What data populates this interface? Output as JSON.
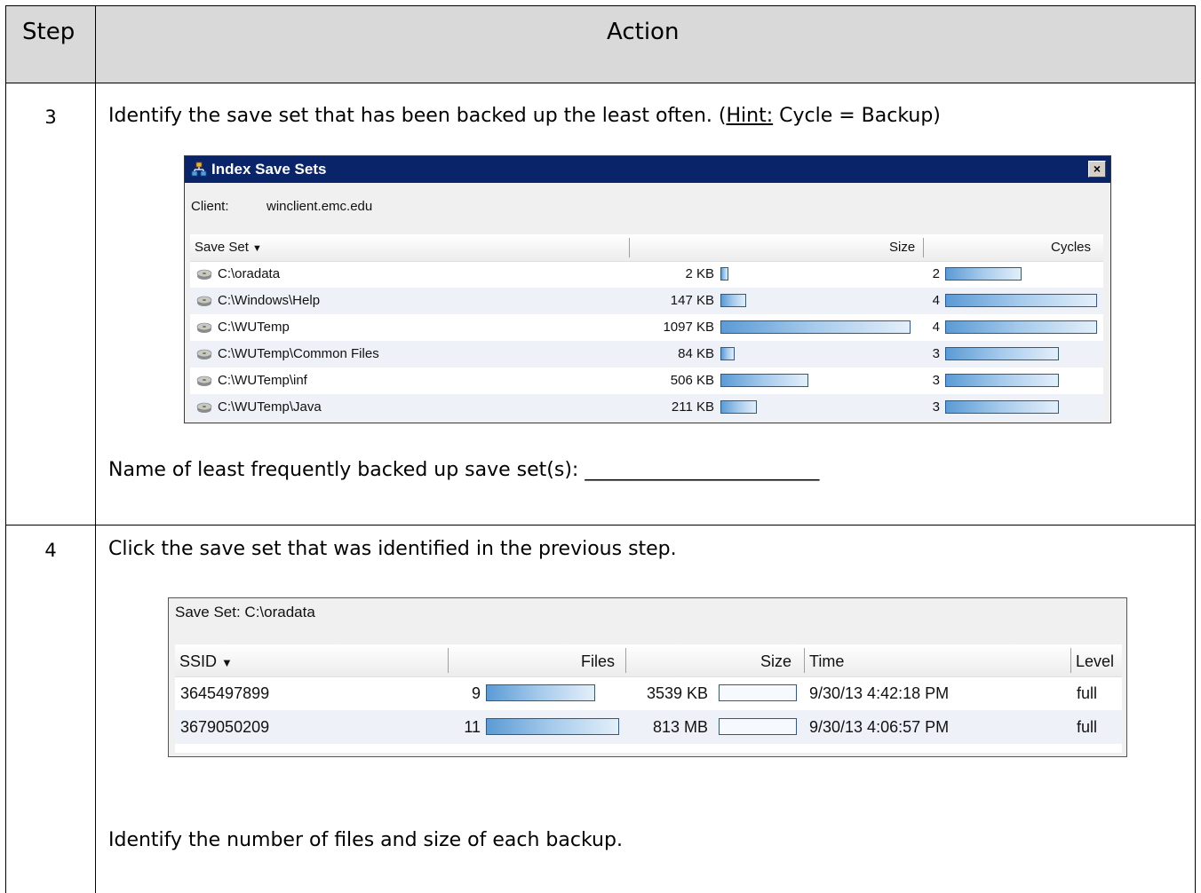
{
  "header": {
    "step": "Step",
    "action": "Action"
  },
  "step3": {
    "num": "3",
    "instruction_pre": "Identify the save set that has been backed up the least often.  (",
    "hint_label": "Hint:",
    "instruction_post": " Cycle = Backup)",
    "dialog": {
      "title": "Index Save Sets",
      "close": "×",
      "client_label": "Client:",
      "client_value": "winclient.emc.edu",
      "col_saveset": "Save Set",
      "col_size": "Size",
      "col_cycles": "Cycles",
      "sort_arrow": "▼",
      "rows": [
        {
          "name": "C:\\oradata",
          "size": "2 KB",
          "size_kb": 2,
          "cycles": "2",
          "cycles_n": 2
        },
        {
          "name": "C:\\Windows\\Help",
          "size": "147 KB",
          "size_kb": 147,
          "cycles": "4",
          "cycles_n": 4
        },
        {
          "name": "C:\\WUTemp",
          "size": "1097 KB",
          "size_kb": 1097,
          "cycles": "4",
          "cycles_n": 4
        },
        {
          "name": "C:\\WUTemp\\Common Files",
          "size": "84 KB",
          "size_kb": 84,
          "cycles": "3",
          "cycles_n": 3
        },
        {
          "name": "C:\\WUTemp\\inf",
          "size": "506 KB",
          "size_kb": 506,
          "cycles": "3",
          "cycles_n": 3
        },
        {
          "name": "C:\\WUTemp\\Java",
          "size": "211 KB",
          "size_kb": 211,
          "cycles": "3",
          "cycles_n": 3
        }
      ]
    },
    "answer_prompt": "Name of least frequently backed up save set(s): ________________________"
  },
  "step4": {
    "num": "4",
    "instruction": "Click the save set that was identified in the previous step.",
    "dialog": {
      "title": "Save Set:  C:\\oradata",
      "col_ssid": "SSID",
      "col_files": "Files",
      "col_size": "Size",
      "col_time": "Time",
      "col_level": "Level",
      "sort_arrow": "▼",
      "rows": [
        {
          "ssid": "3645497899",
          "files": "9",
          "files_n": 9,
          "size": "3539 KB",
          "size_fill": 0.0,
          "time": "9/30/13 4:42:18 PM",
          "level": "full"
        },
        {
          "ssid": "3679050209",
          "files": "11",
          "files_n": 11,
          "size": "813 MB",
          "size_fill": 0.0,
          "time": "9/30/13 4:06:57 PM",
          "level": "full"
        }
      ]
    },
    "followup": "Identify the number of files and size of each backup."
  },
  "colors": {
    "titlebar": "#0a246a",
    "header_bg": "#d9d9d9",
    "bar_border": "#1e5bb0",
    "bar_fill": "#5b9bd5"
  }
}
